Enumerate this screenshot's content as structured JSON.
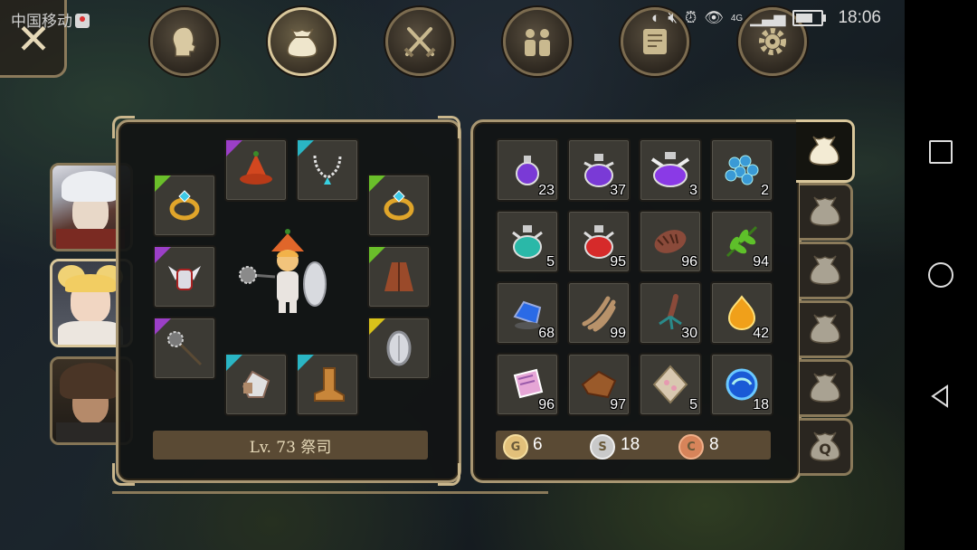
{
  "status_bar": {
    "carrier": "中国移动",
    "network": "4G",
    "time": "18:06"
  },
  "top_nav": [
    {
      "name": "character",
      "icon": "head-silhouette-icon",
      "active": false
    },
    {
      "name": "inventory",
      "icon": "bag-icon",
      "active": true
    },
    {
      "name": "skills",
      "icon": "crossed-swords-icon",
      "active": false
    },
    {
      "name": "party",
      "icon": "people-icon",
      "active": false
    },
    {
      "name": "quests",
      "icon": "scroll-icon",
      "active": false
    },
    {
      "name": "settings",
      "icon": "gear-icon",
      "active": false
    }
  ],
  "portraits": [
    {
      "name": "silver-haired-hero",
      "active": false
    },
    {
      "name": "blonde-priestess",
      "active": true
    },
    {
      "name": "dark-haired-warrior",
      "active": false
    }
  ],
  "equipment": [
    {
      "slot": "ring-left",
      "icon": "gold-ring-icon",
      "rarity": "#6abf2a"
    },
    {
      "slot": "helmet",
      "icon": "witch-hat-icon",
      "rarity": "#9b3fc7"
    },
    {
      "slot": "necklace",
      "icon": "necklace-icon",
      "rarity": "#2ab5c4"
    },
    {
      "slot": "ring-right",
      "icon": "gold-ring-icon",
      "rarity": "#6abf2a"
    },
    {
      "slot": "armor",
      "icon": "winged-armor-icon",
      "rarity": "#9b3fc7"
    },
    {
      "slot": "cloak",
      "icon": "cloak-icon",
      "rarity": "#6abf2a"
    },
    {
      "slot": "weapon",
      "icon": "morning-star-icon",
      "rarity": "#9b3fc7"
    },
    {
      "slot": "shield",
      "icon": "shield-icon",
      "rarity": "#d8c21a"
    },
    {
      "slot": "gloves",
      "icon": "gauntlet-icon",
      "rarity": "#2ab5c4"
    },
    {
      "slot": "boots",
      "icon": "boot-icon",
      "rarity": "#2ab5c4"
    }
  ],
  "level_label": "Lv. 73 祭司",
  "inventory": [
    {
      "icon": "purple-potion-small-icon",
      "qty": "23"
    },
    {
      "icon": "purple-potion-medium-icon",
      "qty": "37"
    },
    {
      "icon": "purple-potion-large-icon",
      "qty": "3"
    },
    {
      "icon": "blue-grapes-icon",
      "qty": "2"
    },
    {
      "icon": "teal-potion-icon",
      "qty": "5"
    },
    {
      "icon": "red-potion-icon",
      "qty": "95"
    },
    {
      "icon": "pine-cone-icon",
      "qty": "96"
    },
    {
      "icon": "green-herb-icon",
      "qty": "94"
    },
    {
      "icon": "blue-gem-icon",
      "qty": "68"
    },
    {
      "icon": "claw-icon",
      "qty": "99"
    },
    {
      "icon": "root-icon",
      "qty": "30"
    },
    {
      "icon": "golden-apple-icon",
      "qty": "42"
    },
    {
      "icon": "magic-scroll-icon",
      "qty": "96"
    },
    {
      "icon": "leather-hide-icon",
      "qty": "97"
    },
    {
      "icon": "crystal-ore-icon",
      "qty": "5"
    },
    {
      "icon": "blue-swirl-orb-icon",
      "qty": "18"
    }
  ],
  "currency": [
    {
      "icon": "gold-coin-icon",
      "letter": "G",
      "amount": "6",
      "color": "#e2c07a"
    },
    {
      "icon": "silver-coin-icon",
      "letter": "S",
      "amount": "18",
      "color": "#c9c9c9"
    },
    {
      "icon": "copper-coin-icon",
      "letter": "C",
      "amount": "8",
      "color": "#d7845a"
    }
  ],
  "bag_tabs": [
    {
      "label": "",
      "active": true
    },
    {
      "label": "",
      "active": false
    },
    {
      "label": "",
      "active": false
    },
    {
      "label": "",
      "active": false
    },
    {
      "label": "",
      "active": false
    },
    {
      "label": "Q",
      "active": false
    }
  ]
}
